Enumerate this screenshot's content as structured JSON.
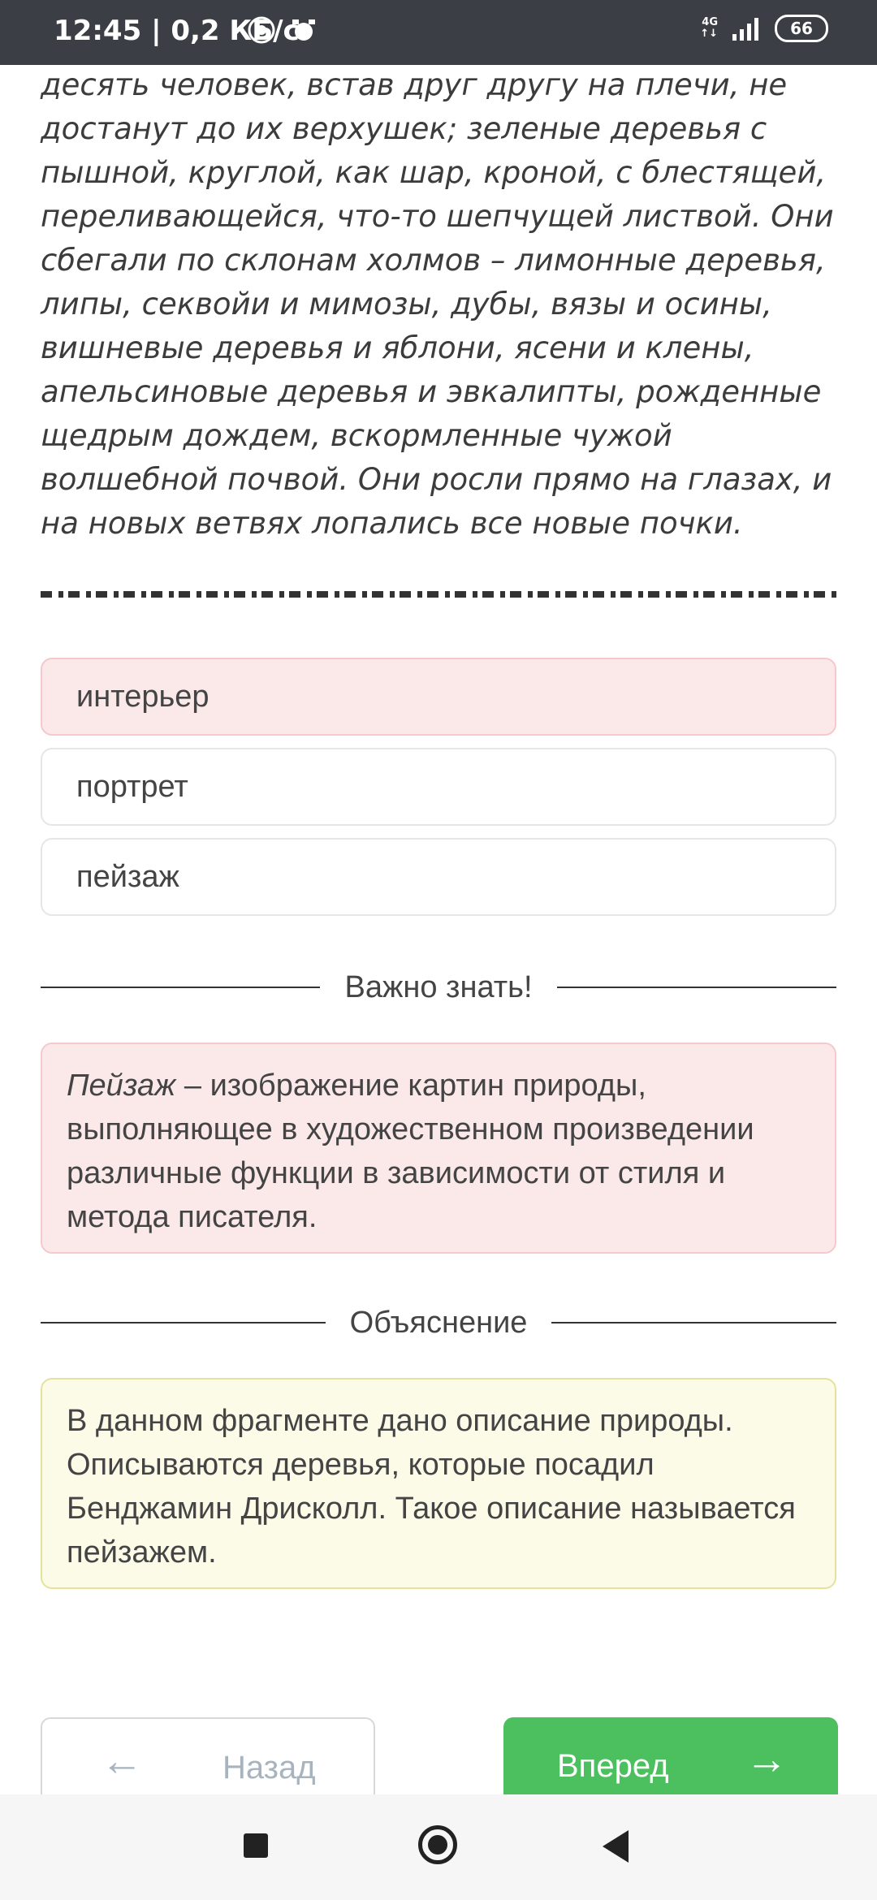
{
  "status_bar": {
    "time": "12:45",
    "speed": "| 0,2 КБ/с",
    "network": "4G",
    "battery": "66"
  },
  "passage": "десять человек, встав друг другу на плечи, не достанут до их верхушек; зеленые деревья с пышной, круглой, как шар, кроной, с блестящей, переливающейся, что-то шепчущей листвой. Они сбегали по склонам холмов – лимонные деревья, липы, секвойи и мимозы, дубы, вязы и осины, вишневые деревья и яблони, ясени и клены, апельсиновые деревья и эвкалипты, рожденные щедрым дождем, вскормленные чужой волшебной почвой. Они росли прямо на глазах, и на новых ветвях лопались все новые почки.",
  "options": [
    {
      "label": "интерьер",
      "selected": true
    },
    {
      "label": "портрет",
      "selected": false
    },
    {
      "label": "пейзаж",
      "selected": false
    }
  ],
  "important": {
    "header": "Важно знать!",
    "term": "Пейзаж",
    "text": " – изображение картин природы, выполняющее в художественном произведении различные функции в зависимости от стиля и метода писателя."
  },
  "explanation": {
    "header": "Объяснение",
    "text": "В данном фрагменте дано описание природы. Описываются деревья, которые посадил Бенджамин Дрисколл. Такое описание называется пейзажем."
  },
  "nav": {
    "back_label": "Назад",
    "next_label": "Вперед"
  },
  "colors": {
    "selected_bg": "#fbe9ea",
    "info_bg": "#fbfbe8",
    "next_button": "#4cbf5f",
    "status_bar": "#3b3f45"
  }
}
